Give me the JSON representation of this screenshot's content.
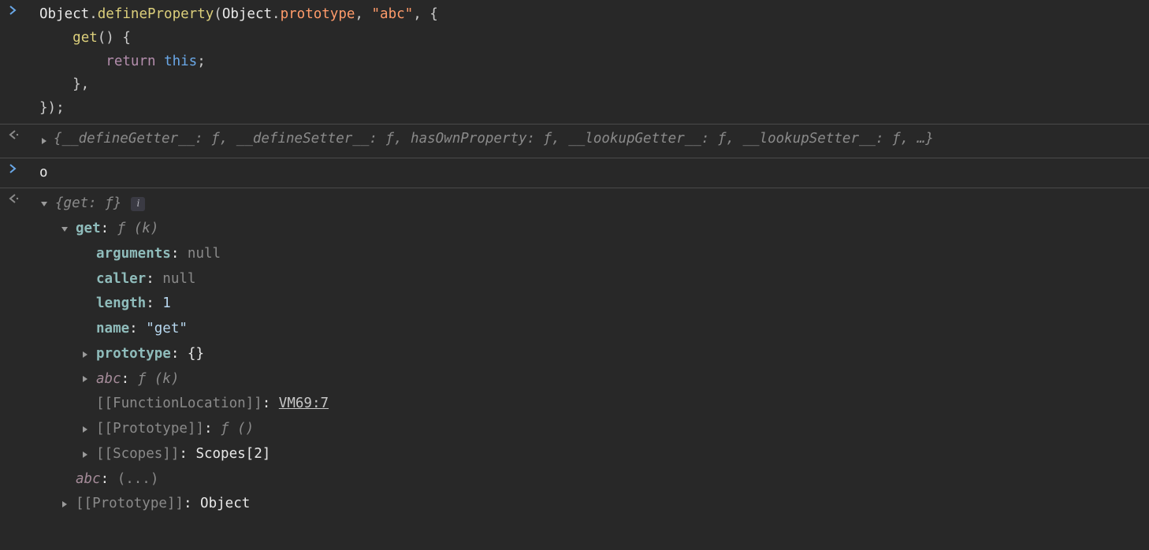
{
  "input1": {
    "l1_a": "Object",
    "l1_b": ".",
    "l1_c": "defineProperty",
    "l1_d": "(",
    "l1_e": "Object",
    "l1_f": ".",
    "l1_g": "prototype",
    "l1_h": ", ",
    "l1_i": "\"abc\"",
    "l1_j": ", {",
    "l2_a": "    ",
    "l2_b": "get",
    "l2_c": "() {",
    "l3_a": "        ",
    "l3_b": "return",
    "l3_c": " ",
    "l3_d": "this",
    "l3_e": ";",
    "l4": "    },",
    "l5": "});"
  },
  "output1": {
    "text": "{__defineGetter__: ƒ, __defineSetter__: ƒ, hasOwnProperty: ƒ, __lookupGetter__: ƒ, __lookupSetter__: ƒ, …}"
  },
  "input2": {
    "text": "o"
  },
  "output2": {
    "summary": "{get: ƒ}",
    "info": "i",
    "get": {
      "label": "get",
      "sig": "ƒ (k)",
      "arguments_k": "arguments",
      "arguments_v": "null",
      "caller_k": "caller",
      "caller_v": "null",
      "length_k": "length",
      "length_v": "1",
      "name_k": "name",
      "name_v": "\"get\"",
      "prototype_k": "prototype",
      "prototype_v": "{}",
      "abc_k": "abc",
      "abc_v": "ƒ (k)",
      "funcloc_k": "[[FunctionLocation]]",
      "funcloc_v": "VM69:7",
      "proto_k": "[[Prototype]]",
      "proto_v": "ƒ ()",
      "scopes_k": "[[Scopes]]",
      "scopes_v": "Scopes[2]"
    },
    "abc_k": "abc",
    "abc_v": "(...)",
    "proto_k": "[[Prototype]]",
    "proto_v": "Object"
  }
}
